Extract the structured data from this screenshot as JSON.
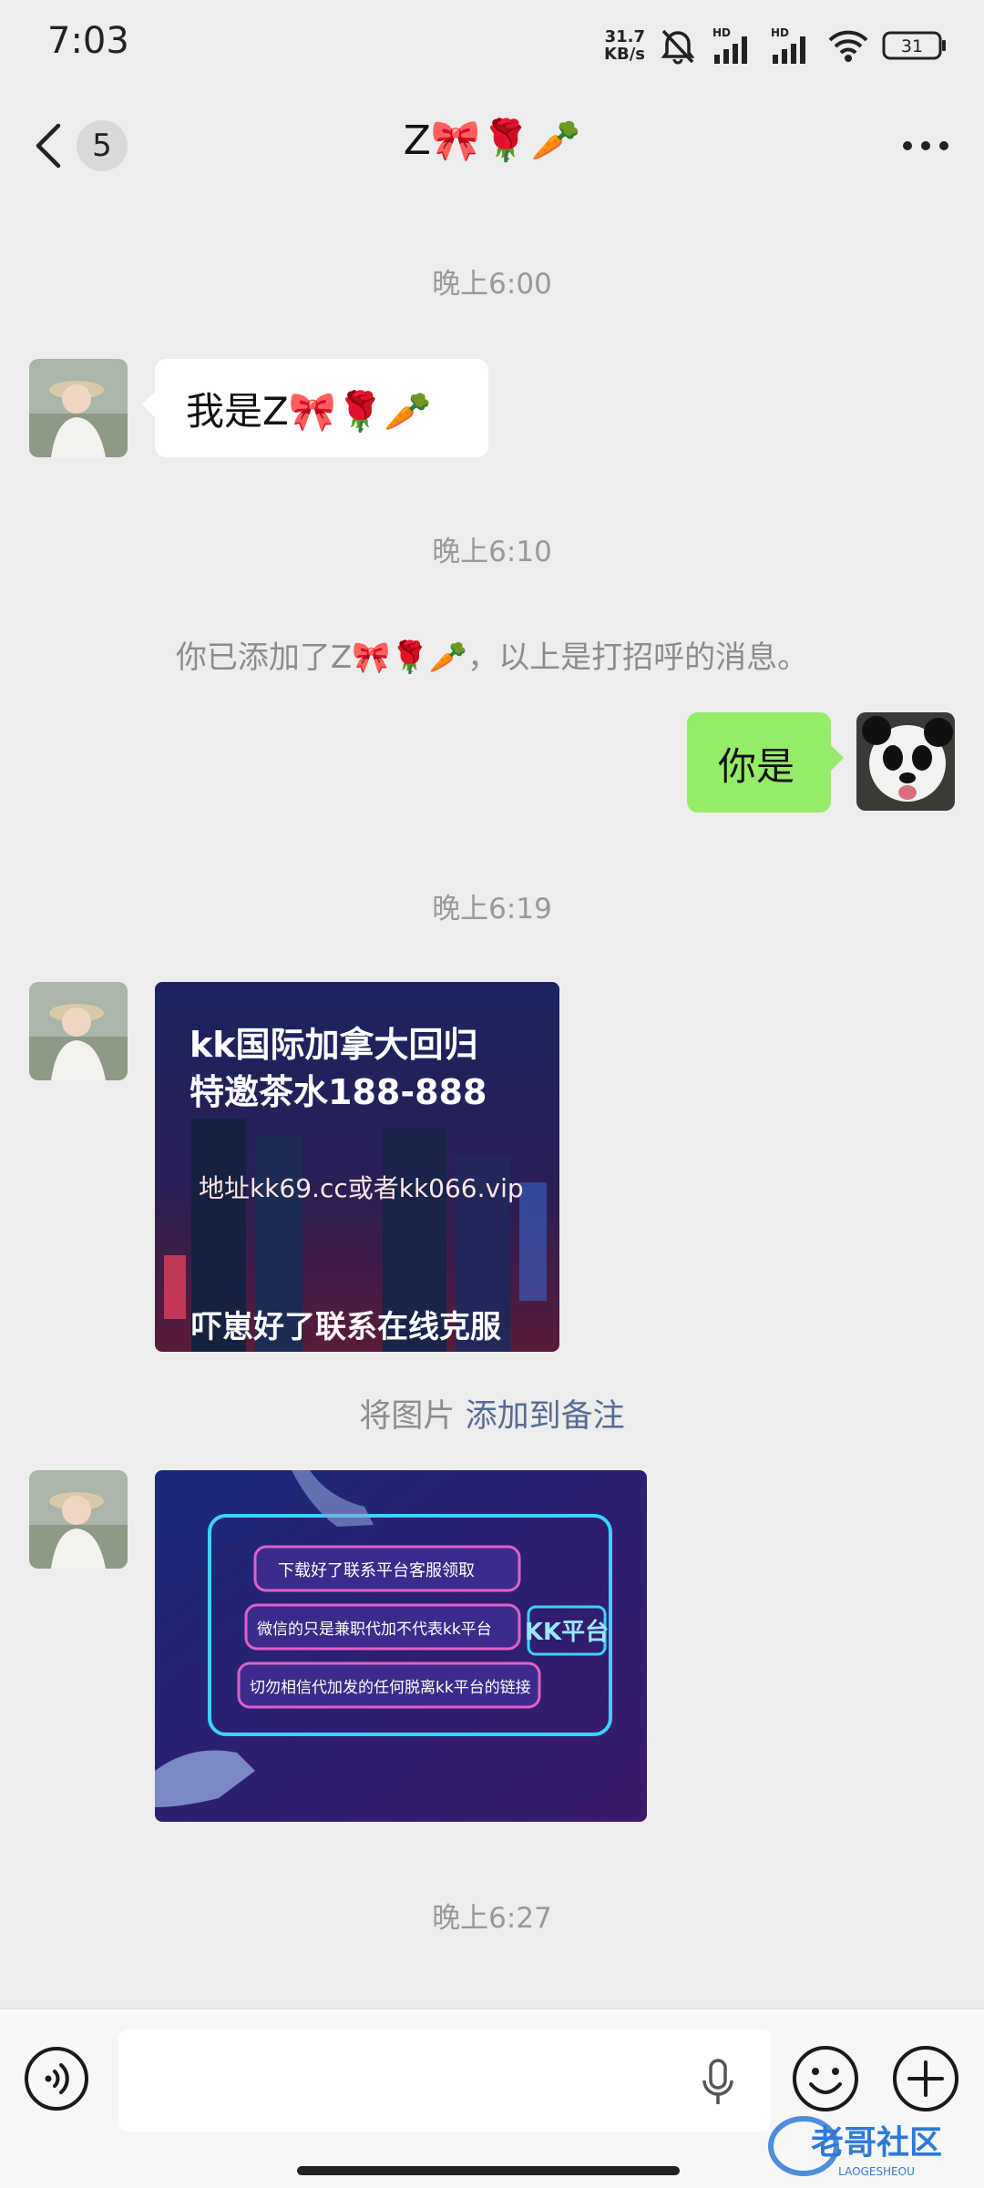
{
  "status_bar": {
    "time": "7:03",
    "net_speed_value": "31.7",
    "net_speed_unit": "KB/s",
    "battery": "31",
    "icons": [
      "mute-alarm-icon",
      "hd-signal-icon",
      "hd-signal-icon",
      "wifi-icon",
      "battery-icon"
    ]
  },
  "header": {
    "back_icon": "chevron-left-icon",
    "unread_count": "5",
    "title": "Z🎀🌹🥕",
    "more_icon": "more-dots-icon"
  },
  "messages": [
    {
      "type": "timestamp",
      "text": "晚上6:00"
    },
    {
      "type": "text",
      "side": "left",
      "text": "我是Z🎀🌹🥕"
    },
    {
      "type": "timestamp",
      "text": "晚上6:10"
    },
    {
      "type": "system",
      "text": "你已添加了Z🎀🌹🥕，以上是打招呼的消息。"
    },
    {
      "type": "text",
      "side": "right",
      "text": "你是"
    },
    {
      "type": "timestamp",
      "text": "晚上6:19"
    },
    {
      "type": "image",
      "side": "left",
      "lines": [
        "kk国际加拿大回归",
        "特邀茶水188-888",
        "地址kk69.cc或者kk066.vip",
        "吓崽好了联系在线克服"
      ]
    },
    {
      "type": "system_link",
      "text": "将图片",
      "link": "添加到备注"
    },
    {
      "type": "image",
      "side": "left",
      "lines": [
        "下载好了联系平台客服领取",
        "微信的只是兼职代加不代表kk平台",
        "切勿相信代加发的任何脱离kk平台的链接",
        "KK平台"
      ]
    },
    {
      "type": "timestamp",
      "text": "晚上6:27"
    }
  ],
  "input_bar": {
    "voice_icon": "voice-mode-icon",
    "input_value": "",
    "mic_icon": "microphone-icon",
    "emoji_icon": "emoji-icon",
    "plus_icon": "plus-circle-icon"
  },
  "watermark": {
    "text": "老哥社区",
    "sub": "LAOGESHEOU"
  },
  "colors": {
    "background": "#ededed",
    "sent_bubble": "#95ec69",
    "received_bubble": "#ffffff",
    "link": "#576b95",
    "muted_text": "#999999"
  }
}
